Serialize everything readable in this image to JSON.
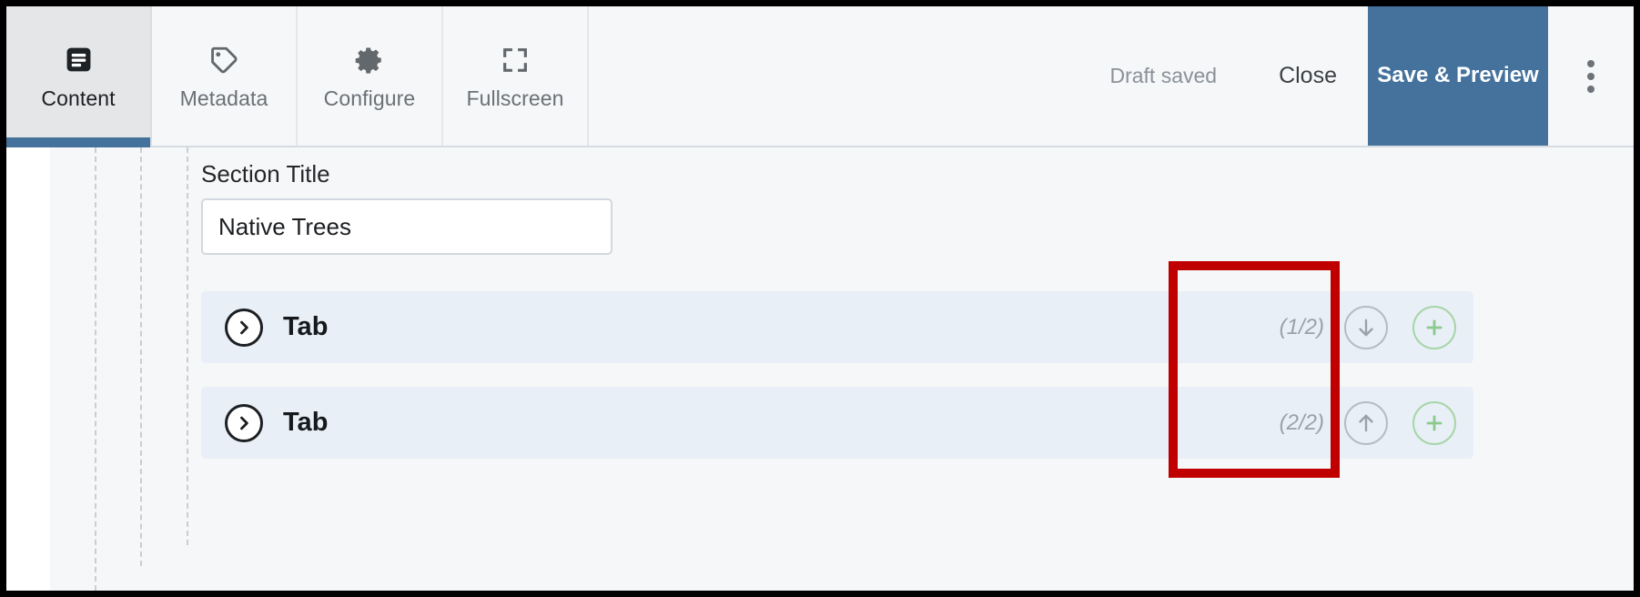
{
  "toolbar": {
    "tabs": [
      {
        "label": "Content",
        "icon": "content-list-icon",
        "active": true
      },
      {
        "label": "Metadata",
        "icon": "tag-icon",
        "active": false
      },
      {
        "label": "Configure",
        "icon": "gear-icon",
        "active": false
      },
      {
        "label": "Fullscreen",
        "icon": "fullscreen-icon",
        "active": false
      }
    ],
    "draft_status": "Draft saved",
    "close_label": "Close",
    "save_preview_label": "Save & Preview",
    "overflow_icon": "kebab-menu-icon",
    "active_tab_accent": "#44729c"
  },
  "editor": {
    "section_title_label": "Section Title",
    "section_title_value": "Native Trees",
    "section_title_placeholder": "Section Title",
    "rows": [
      {
        "label": "Tab",
        "expand_icon": "chevron-right-icon",
        "counter": "(1/2)",
        "move_icon": "arrow-down-icon",
        "add_icon": "plus-circle-icon"
      },
      {
        "label": "Tab",
        "expand_icon": "chevron-right-icon",
        "counter": "(2/2)",
        "move_icon": "arrow-up-icon",
        "add_icon": "plus-circle-icon"
      }
    ],
    "row_background": "#e8eff7",
    "add_icon_color": "#a8d5a8",
    "annotation_color": "#c00000"
  }
}
